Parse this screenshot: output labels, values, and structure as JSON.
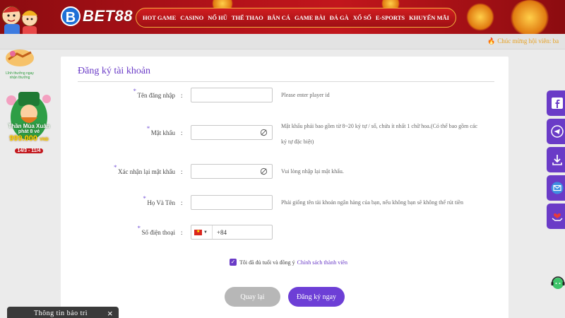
{
  "header": {
    "logo_text": "BET88",
    "logo_letter": "B",
    "nav": [
      "HOT GAME",
      "CASINO",
      "NỔ HŨ",
      "THỂ THAO",
      "BẮN CÁ",
      "GAME BÀI",
      "ĐÁ GÀ",
      "XỔ SỐ",
      "E-SPORTS",
      "KHUYẾN MÃI"
    ]
  },
  "marquee": {
    "message": "Chúc mừng hội viên:  ba"
  },
  "promo": {
    "small_text": "Lĩnh thưởng ngay nhận thưởng",
    "big_title": "Thần Mùa Xuân",
    "big_sub": "phát 8 vé",
    "big_amount": "999.000",
    "big_unit": "VND",
    "big_dates": "14/3 - 11/4"
  },
  "form": {
    "title": "Đăng ký tài khoản",
    "fields": {
      "username": {
        "label": "Tên đăng nhập",
        "value": "",
        "hint": "Please enter player id"
      },
      "password": {
        "label": "Mật khẩu",
        "value": "",
        "hint_line1": "Mật khẩu phải bao gồm từ 8~20 ký tự / số, chứa ít nhất 1 chữ hoa.(Có thể bao gồm các",
        "hint_line2": "ký tự đặc biệt)"
      },
      "confirm": {
        "label": "Xác nhận lại mật khẩu",
        "value": "",
        "hint": "Vui lòng nhập lại mật khẩu."
      },
      "fullname": {
        "label": "Họ Và Tên",
        "value": "",
        "hint": "Phải giống tên tài khoản ngân hàng của bạn, nếu không bạn sẽ không thể rút tiền"
      },
      "phone": {
        "label": "Số điện thoại",
        "value": "+84"
      }
    },
    "colon": ":",
    "agree_text": "Tôi đã đủ tuổi và đồng ý",
    "agree_link": "Chính sách thành viên",
    "back_label": "Quay lại",
    "register_label": "Đăng ký ngay"
  },
  "side_icons": [
    "facebook-icon",
    "telegram-icon",
    "download-icon",
    "mail-icon",
    "heart-hand-icon"
  ],
  "maintenance": {
    "title": "Thông tin bảo trì",
    "close": "×"
  },
  "colors": {
    "accent": "#6a3bc7",
    "header_red": "#b3121a"
  }
}
